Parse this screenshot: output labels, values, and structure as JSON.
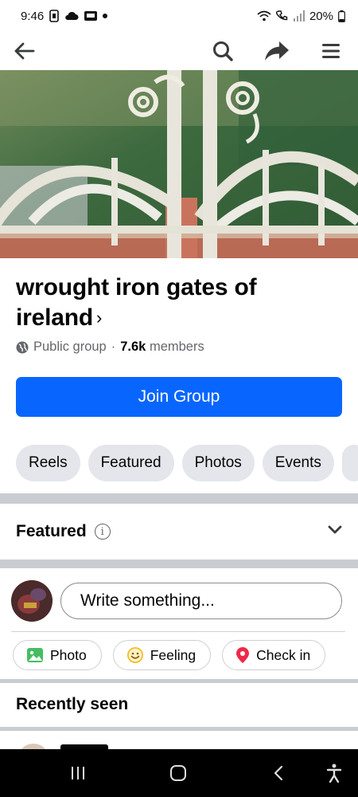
{
  "status_bar": {
    "time": "9:46",
    "battery": "20%",
    "icons": [
      "sim-icon",
      "cloud-icon",
      "notification-badge-icon",
      "dot-icon",
      "wifi-icon",
      "call-icon",
      "signal-icon",
      "battery-icon"
    ]
  },
  "nav": {
    "icons": [
      "back-arrow-icon",
      "search-icon",
      "share-icon",
      "menu-icon"
    ]
  },
  "group": {
    "title": "wrought iron gates of ireland",
    "title_chevron": "›",
    "privacy": "Public group",
    "separator": "·",
    "member_count": "7.6k",
    "members_label": "members",
    "join_label": "Join Group"
  },
  "tabs": [
    "Reels",
    "Featured",
    "Photos",
    "Events"
  ],
  "featured": {
    "label": "Featured",
    "info_glyph": "i"
  },
  "composer": {
    "placeholder": "Write something...",
    "actions": [
      {
        "label": "Photo",
        "icon": "photo-icon"
      },
      {
        "label": "Feeling",
        "icon": "feeling-icon"
      },
      {
        "label": "Check in",
        "icon": "location-pin-icon"
      }
    ]
  },
  "recently_seen": {
    "label": "Recently seen"
  },
  "colors": {
    "accent": "#0866ff",
    "chip_bg": "#e4e6eb",
    "secondary_text": "#65676b",
    "photo_green": "#45bd62",
    "feeling_yellow": "#f7b928",
    "checkin_red": "#f02849"
  }
}
